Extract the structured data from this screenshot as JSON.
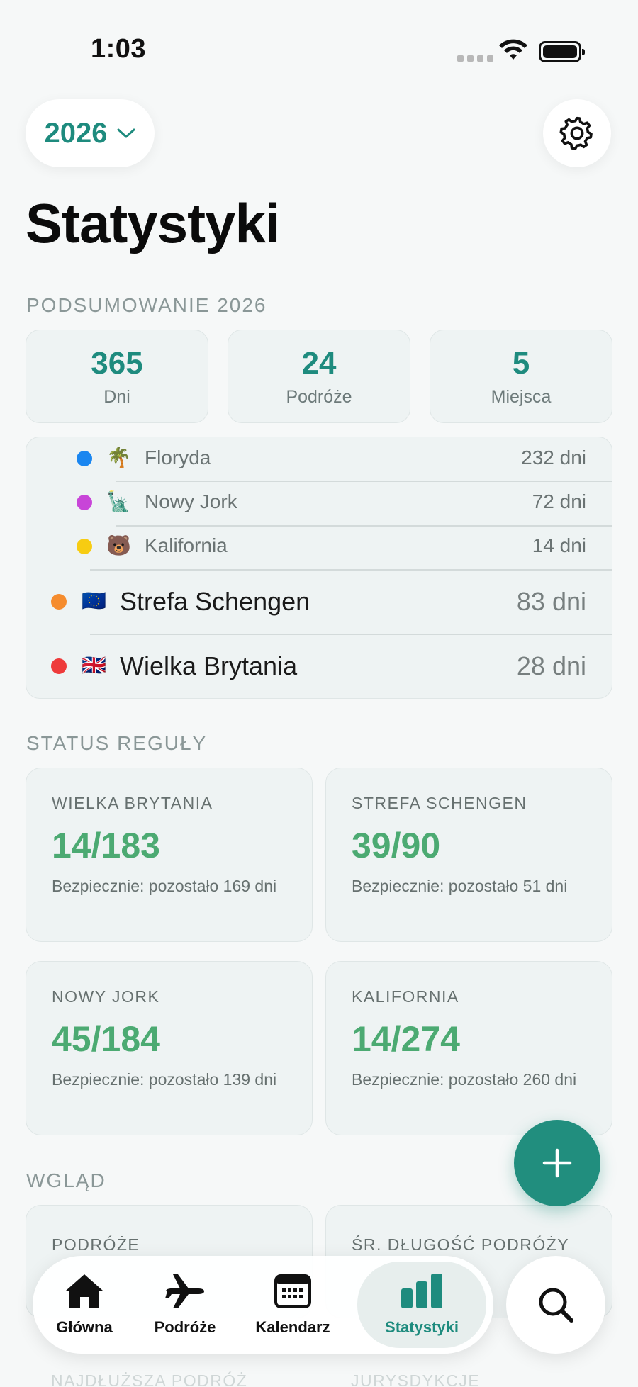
{
  "status_bar": {
    "time": "1:03"
  },
  "header": {
    "year": "2026",
    "title": "Statystyki"
  },
  "summary": {
    "label": "PODSUMOWANIE 2026",
    "boxes": [
      {
        "value": "365",
        "label": "Dni"
      },
      {
        "value": "24",
        "label": "Podróże"
      },
      {
        "value": "5",
        "label": "Miejsca"
      }
    ]
  },
  "places": [
    {
      "name": "Floryda",
      "days": "232 dni",
      "flag": "🌴",
      "color": "#1a86f0",
      "level": "sub"
    },
    {
      "name": "Nowy Jork",
      "days": "72 dni",
      "flag": "🗽",
      "color": "#c845d8",
      "level": "sub"
    },
    {
      "name": "Kalifornia",
      "days": "14 dni",
      "flag": "🐻",
      "color": "#f7cc12",
      "level": "sub"
    },
    {
      "name": "Strefa Schengen",
      "days": "83 dni",
      "flag": "🇪🇺",
      "color": "#f58c2e",
      "level": "main"
    },
    {
      "name": "Wielka Brytania",
      "days": "28 dni",
      "flag": "🇬🇧",
      "color": "#ee3a3a",
      "level": "main"
    }
  ],
  "rules": {
    "label": "STATUS REGUŁY",
    "cards": [
      {
        "label": "WIELKA BRYTANIA",
        "value": "14/183",
        "text": "Bezpiecznie: pozostało 169 dni"
      },
      {
        "label": "STREFA SCHENGEN",
        "value": "39/90",
        "text": "Bezpiecznie: pozostało 51 dni"
      },
      {
        "label": "NOWY JORK",
        "value": "45/184",
        "text": "Bezpiecznie: pozostało 139 dni"
      },
      {
        "label": "KALIFORNIA",
        "value": "14/274",
        "text": "Bezpiecznie: pozostało 260 dni"
      }
    ]
  },
  "insights": {
    "label": "WGLĄD",
    "cards": [
      {
        "label": "PODRÓŻE"
      },
      {
        "label": "ŚR. DŁUGOŚĆ PODRÓŻY"
      }
    ],
    "faded": [
      "NAJDŁUŻSZA PODRÓŻ",
      "JURYSDYKCJE"
    ]
  },
  "tabbar": {
    "tabs": [
      {
        "label": "Główna",
        "icon": "house-icon"
      },
      {
        "label": "Podróże",
        "icon": "airplane-icon"
      },
      {
        "label": "Kalendarz",
        "icon": "calendar-icon"
      },
      {
        "label": "Statystyki",
        "icon": "chart-icon",
        "active": true
      }
    ]
  },
  "colors": {
    "accent": "#1e8b7e",
    "safe": "#4caa72",
    "background": "#f6f8f8"
  }
}
